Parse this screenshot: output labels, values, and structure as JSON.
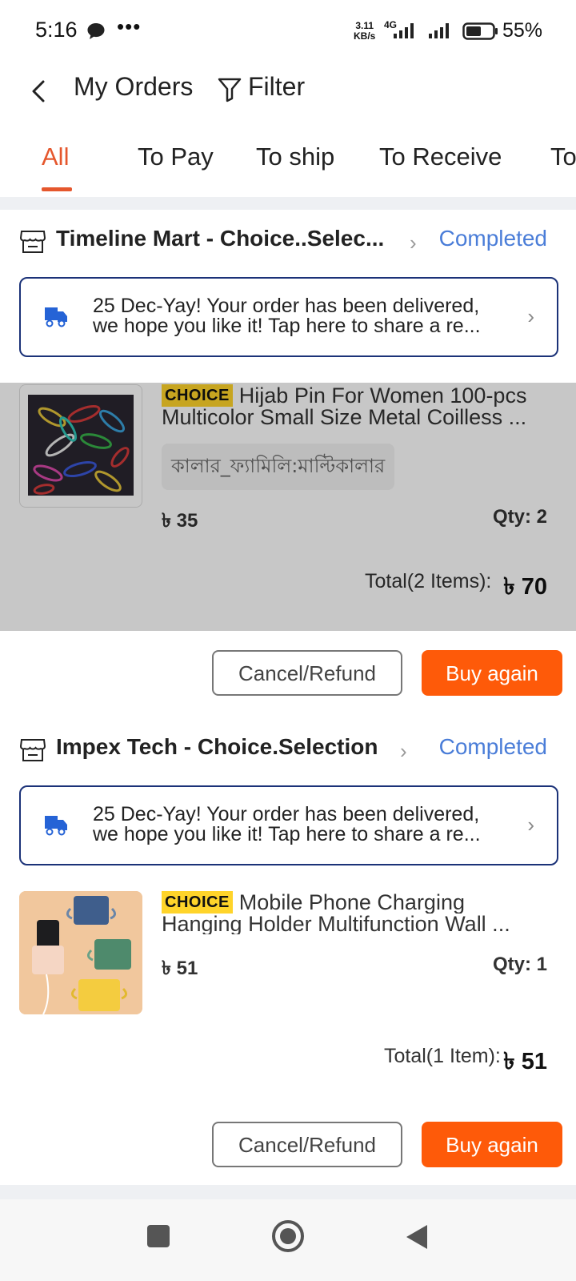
{
  "status_bar": {
    "time": "5:16",
    "dots": "•••",
    "speed_value": "3.11",
    "speed_unit": "KB/s",
    "network": "4G",
    "battery": "55%"
  },
  "header": {
    "title": "My Orders",
    "filter_label": "Filter"
  },
  "tabs": [
    {
      "label": "All",
      "active": true
    },
    {
      "label": "To Pay",
      "active": false
    },
    {
      "label": "To ship",
      "active": false
    },
    {
      "label": "To Receive",
      "active": false
    },
    {
      "label": "To",
      "active": false
    }
  ],
  "orders": [
    {
      "store": "Timeline Mart - Choice..Selec...",
      "status": "Completed",
      "delivery_line1": "25 Dec-Yay! Your order has been delivered,",
      "delivery_line2": "we hope you like it!  Tap here to share a re...",
      "product": {
        "badge": "CHOICE",
        "title_line1": "Hijab Pin For Women 100-pcs",
        "title_line2": "Multicolor Small Size Metal Coilless ...",
        "variant": "কালার_ফ্যামিলি:মাল্টিকালার",
        "price": "৳ 35",
        "qty": "Qty: 2"
      },
      "total_label": "Total(2 Items):",
      "total_value": "৳ 70",
      "cancel_label": "Cancel/Refund",
      "buy_label": "Buy again"
    },
    {
      "store": "Impex Tech - Choice.Selection",
      "status": "Completed",
      "delivery_line1": "25 Dec-Yay! Your order has been delivered,",
      "delivery_line2": "we hope you like it!  Tap here to share a re...",
      "product": {
        "badge": "CHOICE",
        "title_line1": "Mobile Phone Charging",
        "title_line2": "Hanging Holder Multifunction Wall ...",
        "price": "৳ 51",
        "qty": "Qty: 1"
      },
      "total_label": "Total(1 Item):",
      "total_value": "৳ 51",
      "cancel_label": "Cancel/Refund",
      "buy_label": "Buy again"
    }
  ],
  "colors": {
    "accent": "#e5572d",
    "button_primary": "#fe5a09",
    "status_blue": "#4a7dd8",
    "delivery_border": "#1b3278",
    "choice_badge": "#ffd42a"
  },
  "icons": [
    "chat-icon",
    "back-arrow-icon",
    "filter-funnel-icon",
    "store-icon",
    "delivery-truck-icon",
    "chevron-right-icon",
    "nav-square-icon",
    "nav-home-icon",
    "nav-back-triangle-icon"
  ]
}
